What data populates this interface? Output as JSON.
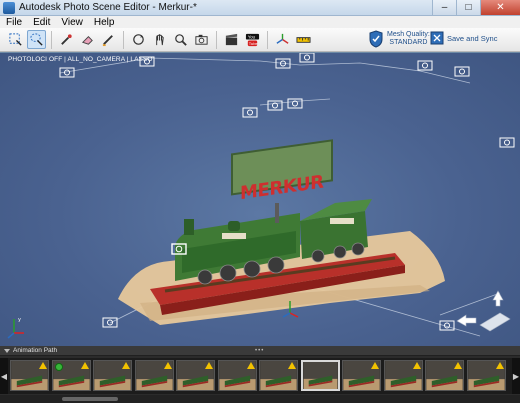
{
  "window": {
    "title": "Autodesk Photo Scene Editor - Merkur-*",
    "minimize": "–",
    "maximize": "□",
    "close": "✕"
  },
  "menu": [
    "File",
    "Edit",
    "View",
    "Help"
  ],
  "toolbar": {
    "tools": [
      "rectangle-select",
      "lasso-select",
      "eyedropper",
      "eraser",
      "pen",
      "orbit",
      "pan",
      "zoom",
      "camera",
      "film",
      "youtube",
      "axis",
      "measure"
    ],
    "active_tool": "lasso-select",
    "mesh_quality_label": "Mesh Quality:",
    "mesh_quality_value": "STANDARD",
    "save_sync_label": "Save and Sync"
  },
  "viewport": {
    "status_label": "PHOTOLOCI OFF | ALL_NO_CAMERA | LASSO",
    "sign_text": "MERKUR",
    "model_plate_text": "MERKUR"
  },
  "animation": {
    "title": "Animation Path",
    "grip": "•••",
    "frames": [
      {
        "warn": true,
        "good": false
      },
      {
        "warn": true,
        "good": true
      },
      {
        "warn": true,
        "good": false
      },
      {
        "warn": true,
        "good": false
      },
      {
        "warn": true,
        "good": false
      },
      {
        "warn": true,
        "good": false
      },
      {
        "warn": true,
        "good": false
      },
      {
        "warn": false,
        "good": false,
        "selected": true
      },
      {
        "warn": true,
        "good": false
      },
      {
        "warn": true,
        "good": false
      },
      {
        "warn": true,
        "good": false
      },
      {
        "warn": true,
        "good": false
      }
    ]
  },
  "colors": {
    "viewport_bg": "#4a6290",
    "title_bar": "#c5d7ea",
    "accent_blue": "#1f4f8a",
    "warn_yellow": "#f2c200",
    "ok_green": "#38b53a"
  }
}
